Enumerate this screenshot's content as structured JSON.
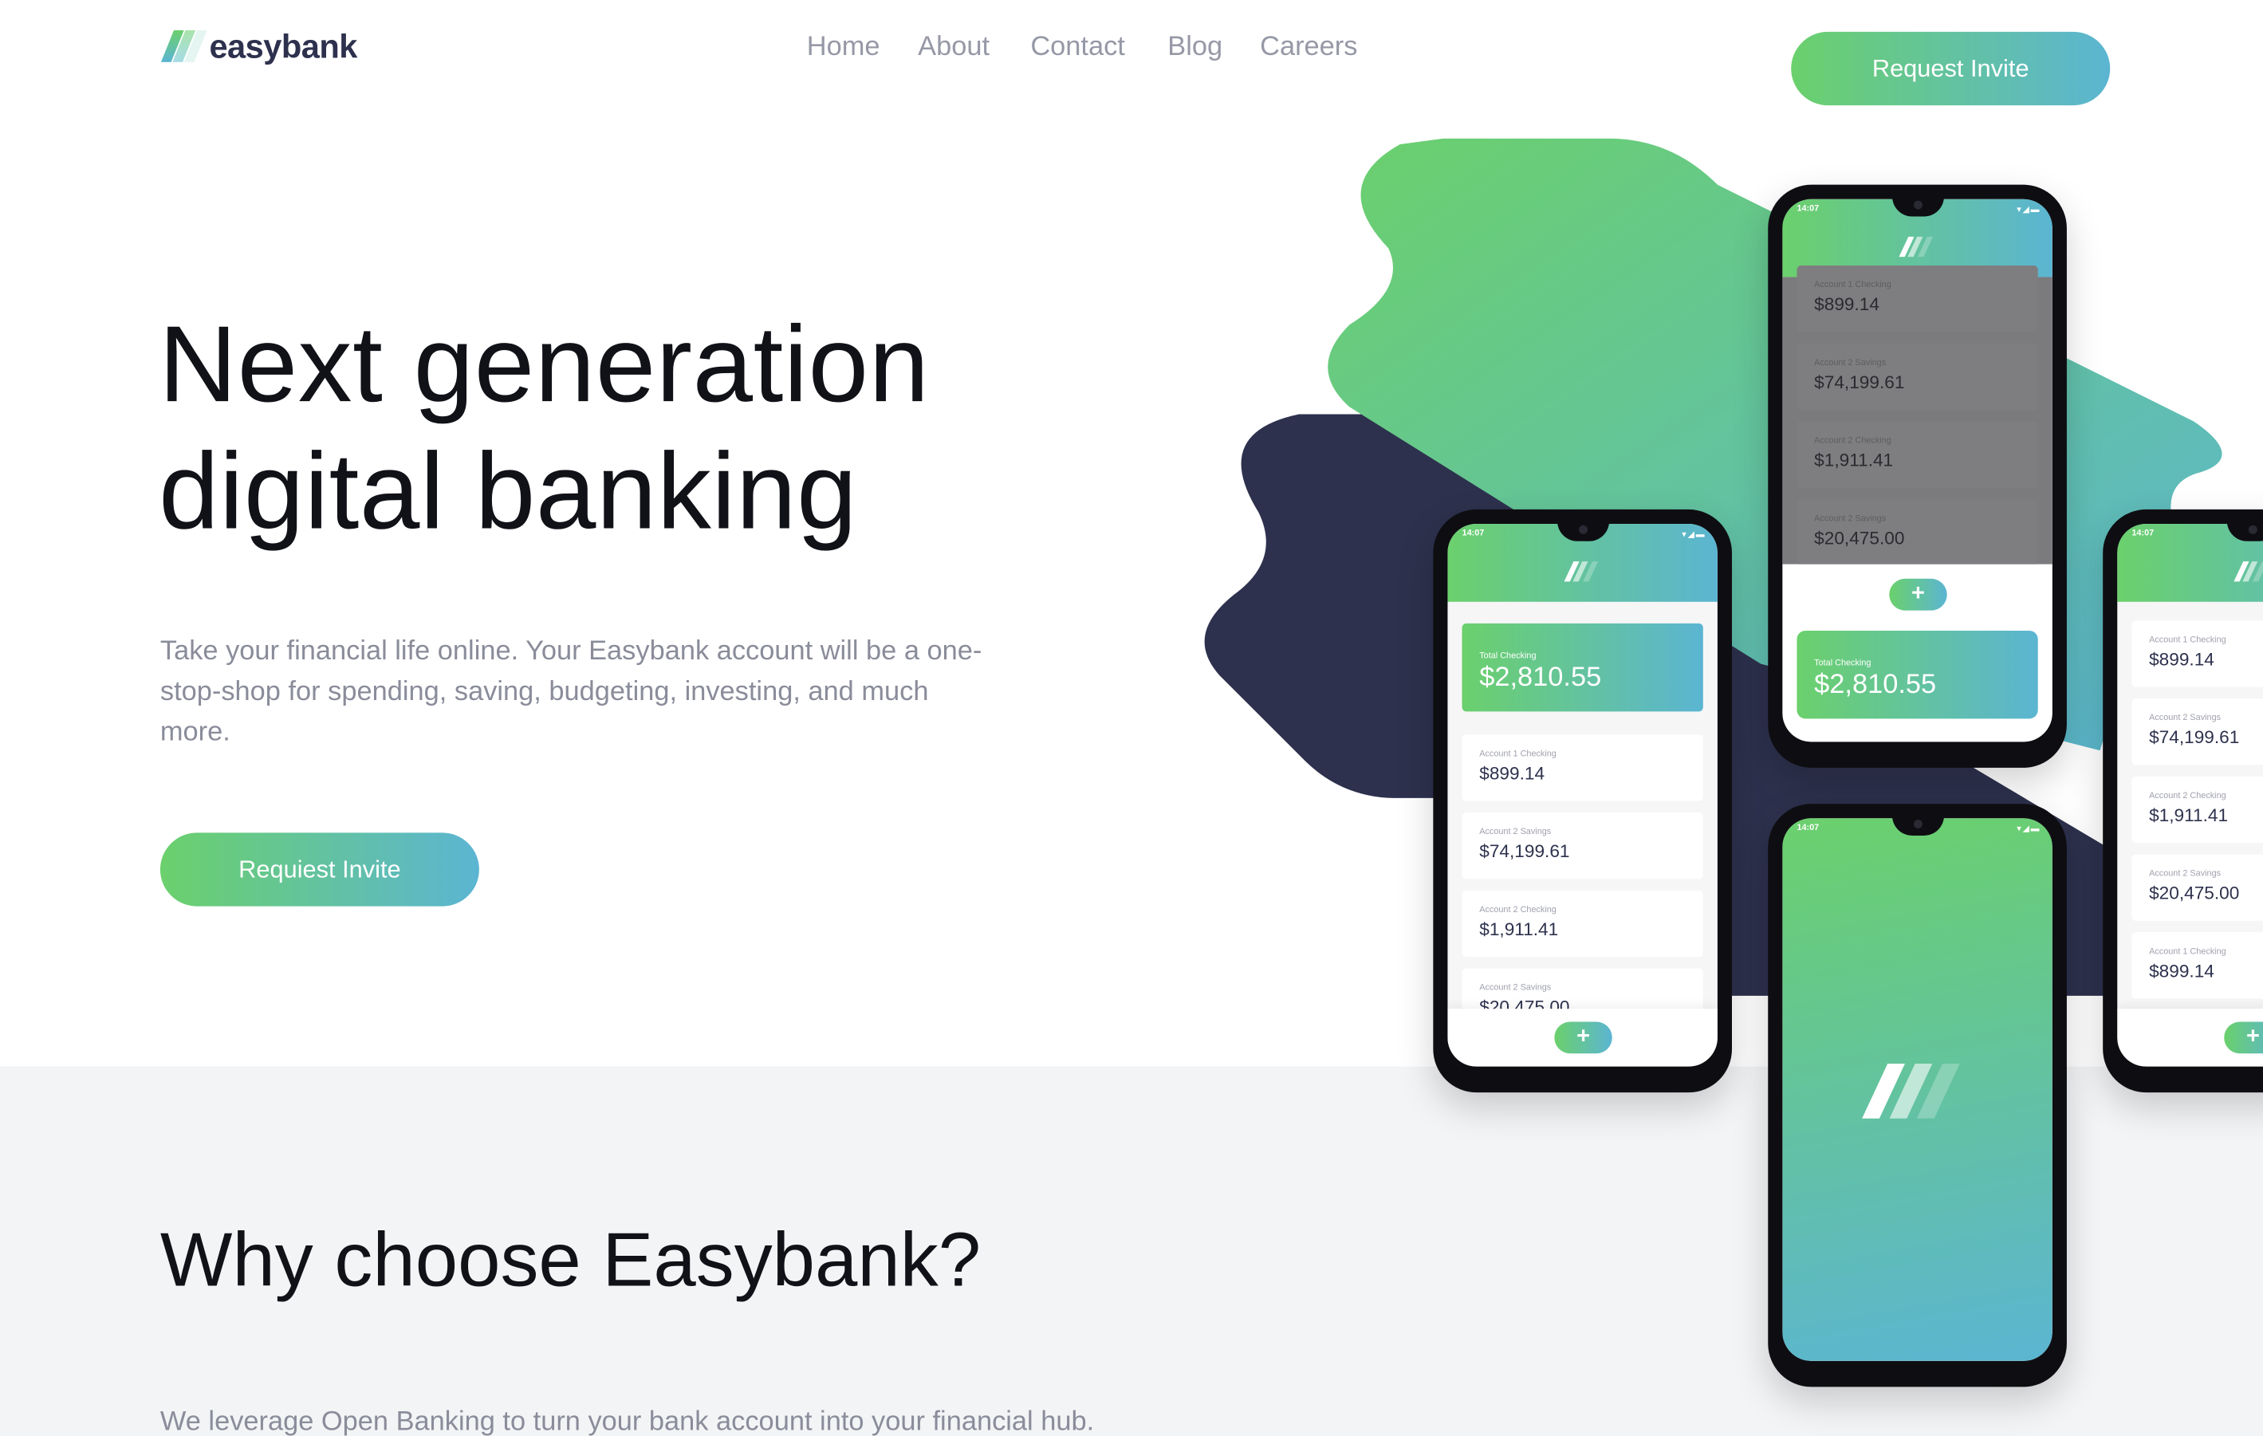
{
  "brand": {
    "name": "easybank",
    "colors": {
      "green": "#6bd06c",
      "cyan": "#5bb5d2",
      "navy": "#2d314d",
      "gray_text": "#9698a6",
      "section_bg": "#f3f4f6"
    }
  },
  "nav": {
    "items": [
      "Home",
      "About",
      "Contact",
      "Blog",
      "Careers"
    ]
  },
  "header": {
    "cta_label": "Request Invite"
  },
  "hero": {
    "title_line1": "Next generation",
    "title_line2": "digital banking",
    "text": "Take your financial life online. Your Easybank account will be a one-stop-shop for spending, saving, budgeting, investing, and much more.",
    "cta_label": "Requiest Invite"
  },
  "why": {
    "title": "Why choose Easybank?",
    "text": "We leverage Open Banking to turn your bank account into your financial hub."
  },
  "phones": [
    {
      "kind": "list",
      "status_time": "14:07",
      "total": {
        "label": "Total Checking",
        "amount": "$2,810.55"
      },
      "accounts": [
        {
          "label": "Account 1 Checking",
          "amount": "$899.14"
        },
        {
          "label": "Account 2 Savings",
          "amount": "$74,199.61"
        },
        {
          "label": "Account 2 Checking",
          "amount": "$1,911.41"
        },
        {
          "label": "Account 2 Savings",
          "amount": "$20,475.00"
        }
      ],
      "add_icon": "plus-icon"
    },
    {
      "kind": "sheet",
      "status_time": "14:07",
      "total": {
        "label": "Total Checking",
        "amount": "$2,810.55"
      },
      "accounts": [
        {
          "label": "Account 1 Checking",
          "amount": "$899.14"
        },
        {
          "label": "Account 2 Savings",
          "amount": "$74,199.61"
        },
        {
          "label": "Account 2 Checking",
          "amount": "$1,911.41"
        },
        {
          "label": "Account 2 Savings",
          "amount": "$20,475.00"
        }
      ],
      "add_icon": "plus-icon"
    },
    {
      "kind": "splash",
      "status_time": "14:07"
    },
    {
      "kind": "plain",
      "status_time": "14:07",
      "accounts": [
        {
          "label": "Account 1 Checking",
          "amount": "$899.14"
        },
        {
          "label": "Account 2 Savings",
          "amount": "$74,199.61"
        },
        {
          "label": "Account 2 Checking",
          "amount": "$1,911.41"
        },
        {
          "label": "Account 2 Savings",
          "amount": "$20,475.00"
        },
        {
          "label": "Account 1 Checking",
          "amount": "$899.14"
        }
      ],
      "add_icon": "plus-icon"
    }
  ]
}
